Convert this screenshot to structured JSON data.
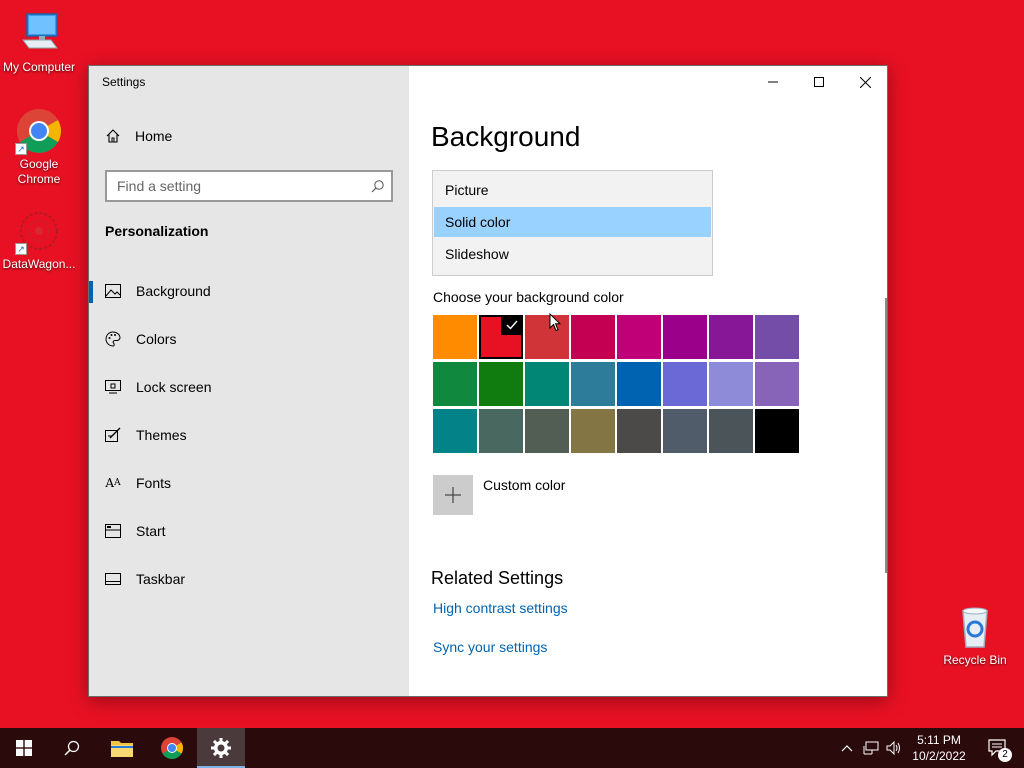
{
  "desktop": {
    "icons": [
      {
        "label": "My Computer"
      },
      {
        "label": "Google Chrome"
      },
      {
        "label": "DataWagon..."
      },
      {
        "label": "Recycle Bin"
      }
    ],
    "background_color": "#e81123"
  },
  "window": {
    "title": "Settings",
    "controls": {
      "minimize": "minimize-icon",
      "maximize": "maximize-icon",
      "close": "close-icon"
    }
  },
  "sidebar": {
    "home_label": "Home",
    "search_placeholder": "Find a setting",
    "section_title": "Personalization",
    "items": [
      {
        "label": "Background",
        "icon": "picture-icon",
        "active": true
      },
      {
        "label": "Colors",
        "icon": "palette-icon",
        "active": false
      },
      {
        "label": "Lock screen",
        "icon": "lock-screen-icon",
        "active": false
      },
      {
        "label": "Themes",
        "icon": "themes-icon",
        "active": false
      },
      {
        "label": "Fonts",
        "icon": "fonts-icon",
        "active": false
      },
      {
        "label": "Start",
        "icon": "start-icon",
        "active": false
      },
      {
        "label": "Taskbar",
        "icon": "taskbar-icon",
        "active": false
      }
    ]
  },
  "main": {
    "page_title": "Background",
    "background_dropdown": {
      "options": [
        "Picture",
        "Solid color",
        "Slideshow"
      ],
      "selected": "Solid color"
    },
    "choose_color_label": "Choose your background color",
    "colors": [
      "#ff8c00",
      "#e81123",
      "#d13438",
      "#c30052",
      "#bf0077",
      "#9a0089",
      "#881798",
      "#744da9",
      "#10893e",
      "#107c10",
      "#018574",
      "#2d7d9a",
      "#0063b1",
      "#6b69d6",
      "#8e8cd8",
      "#8764b8",
      "#038387",
      "#486860",
      "#525e54",
      "#847545",
      "#4c4a48",
      "#515c6b",
      "#4a5459",
      "#000000"
    ],
    "selected_color_index": 1,
    "custom_color_label": "Custom color",
    "related_settings_title": "Related Settings",
    "links": [
      "High contrast settings",
      "Sync your settings"
    ]
  },
  "taskbar": {
    "apps": [
      "start-icon",
      "search-icon",
      "file-explorer-icon",
      "chrome-icon",
      "settings-icon"
    ],
    "active_app": "settings-icon",
    "time": "5:11 PM",
    "date": "10/2/2022",
    "notification_count": "2"
  }
}
